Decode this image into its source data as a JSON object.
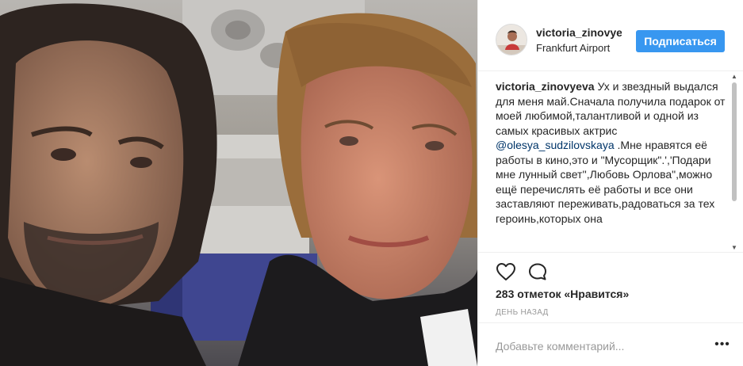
{
  "post": {
    "username": "victoria_zinovyeva",
    "location": "Frankfurt Airport",
    "follow_label": "Подписаться",
    "caption_user": "victoria_zinovyeva",
    "caption_before": "Ух и звездный выдался для меня май.Сначала получила подарок от моей любимой,талантливой и одной из самых красивых актрис ",
    "caption_mention": "@olesya_sudzilovskaya",
    "caption_after": " .Мне нравятся её работы в кино,это и \"Мусорщик\".','Подари мне лунный свет'',Любовь Орлова\",можно ещё перечислять её работы и все они заставляют переживать,радоваться за тех героинь,которых она",
    "likes": "283 отметок «Нравится»",
    "timestamp": "ДЕНЬ НАЗАД",
    "comment_placeholder": "Добавьте комментарий...",
    "more_label": "•••"
  },
  "colors": {
    "follow_button": "#3897f0",
    "mention": "#003569",
    "secondary_text": "#999999"
  },
  "icons": {
    "like": "heart-outline-icon",
    "comment": "speech-bubble-icon",
    "more": "more-options-icon"
  }
}
